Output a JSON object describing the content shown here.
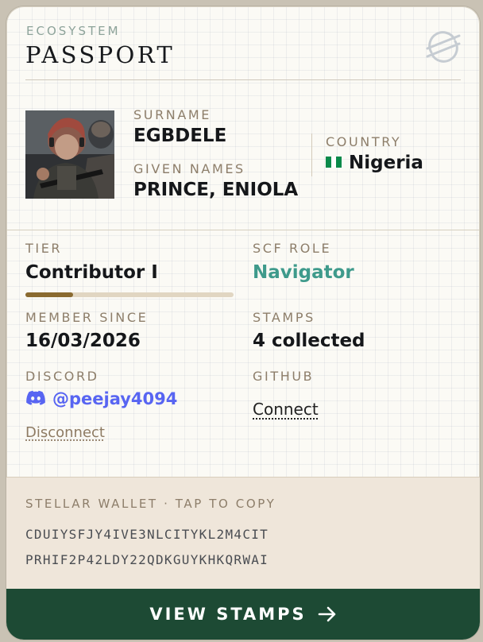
{
  "header": {
    "eyebrow": "ECOSYSTEM",
    "title": "PASSPORT",
    "logo_icon": "stellar-logo-icon"
  },
  "identity": {
    "surname_label": "SURNAME",
    "surname": "EGBDELE",
    "given_label": "GIVEN NAMES",
    "given": "PRINCE, ENIOLA",
    "country_label": "COUNTRY",
    "country": "Nigeria",
    "flag_colors": [
      "#0a8a4a",
      "#ffffff",
      "#0a8a4a"
    ]
  },
  "details": {
    "tier_label": "TIER",
    "tier": "Contributor I",
    "tier_progress": 0.23,
    "role_label": "SCF ROLE",
    "role": "Navigator",
    "since_label": "MEMBER SINCE",
    "since": "16/03/2026",
    "stamps_label": "STAMPS",
    "stamps": "4 collected",
    "discord_label": "DISCORD",
    "discord_handle": "@peejay4094",
    "discord_action": "Disconnect",
    "github_label": "GITHUB",
    "github_action": "Connect"
  },
  "wallet": {
    "label": "STELLAR WALLET · TAP TO COPY",
    "line1": "CDUIYSFJY4IVE3NLCITYKL2M4CIT",
    "line2": "PRHIF2P42LDY22QDKGUYKHKQRWAI"
  },
  "cta": {
    "label": "VIEW STAMPS"
  },
  "colors": {
    "accent_green": "#1d4a34",
    "role_teal": "#3e9a8b",
    "discord_blue": "#5865f2",
    "progress_brown": "#8a6a30"
  }
}
